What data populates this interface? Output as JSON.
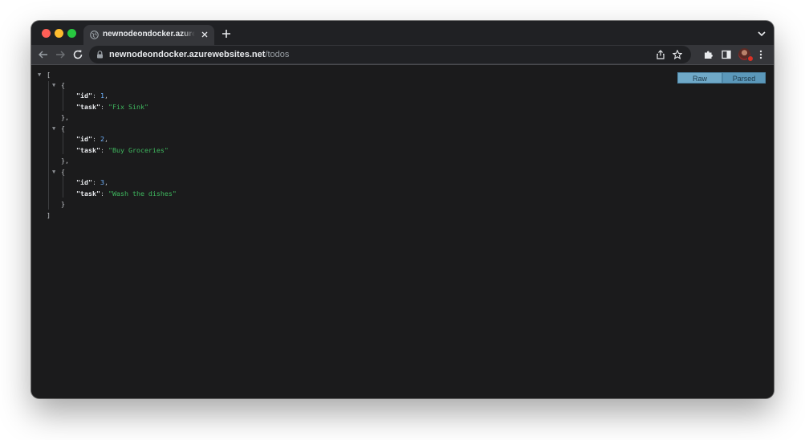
{
  "browser": {
    "tab_title": "newnodeondocker.azurewebsites.net/todos",
    "url_host": "newnodeondocker.azurewebsites.net",
    "url_path": "/todos"
  },
  "viewer": {
    "raw_label": "Raw",
    "parsed_label": "Parsed",
    "active_mode": "Parsed"
  },
  "json_lines": {
    "open_array": "[",
    "close_array": "]",
    "open_obj": "{",
    "close_obj_comma": "},",
    "close_obj": "}",
    "key_id": "\"id\"",
    "key_task": "\"task\"",
    "colon": ": ",
    "comma": ","
  },
  "todos": [
    {
      "id": "1",
      "task": "\"Fix Sink\""
    },
    {
      "id": "2",
      "task": "\"Buy Groceries\""
    },
    {
      "id": "3",
      "task": "\"Wash the dishes\""
    }
  ],
  "colors": {
    "key": "#e8eaed",
    "number": "#6fb3ff",
    "string": "#3fb95f",
    "toggle_active": "#5b98ba"
  },
  "icons": [
    "globe-icon",
    "close-icon",
    "plus-icon",
    "chevron-down-icon",
    "back-arrow-icon",
    "forward-arrow-icon",
    "reload-icon",
    "lock-icon",
    "share-icon",
    "star-icon",
    "puzzle-icon",
    "side-panel-icon",
    "kebab-menu-icon"
  ]
}
